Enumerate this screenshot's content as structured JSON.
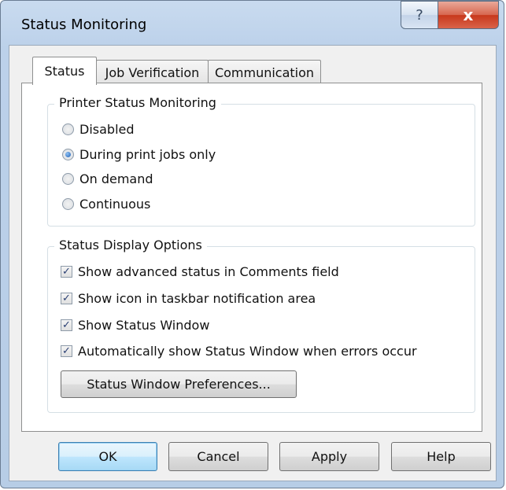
{
  "window": {
    "title": "Status Monitoring",
    "help_glyph": "?",
    "close_glyph": "x"
  },
  "tabs": [
    {
      "label": "Status",
      "active": true
    },
    {
      "label": "Job Verification",
      "active": false
    },
    {
      "label": "Communication",
      "active": false
    }
  ],
  "printer_status": {
    "legend": "Printer Status Monitoring",
    "selected": "During print jobs only",
    "options": [
      "Disabled",
      "During print jobs only",
      "On demand",
      "Continuous"
    ]
  },
  "display_options": {
    "legend": "Status Display Options",
    "checkboxes": [
      {
        "label": "Show advanced status in Comments field",
        "checked": true
      },
      {
        "label": "Show icon in taskbar notification area",
        "checked": true
      },
      {
        "label": "Show Status Window",
        "checked": true
      },
      {
        "label": "Automatically show Status Window when errors occur",
        "checked": true
      }
    ],
    "preferences_button": "Status Window Preferences..."
  },
  "buttons": {
    "ok": "OK",
    "cancel": "Cancel",
    "apply": "Apply",
    "help": "Help"
  },
  "colors": {
    "frame": "#bcd1ea",
    "close_button": "#c8381c",
    "default_button_border": "#3c7fb1"
  }
}
